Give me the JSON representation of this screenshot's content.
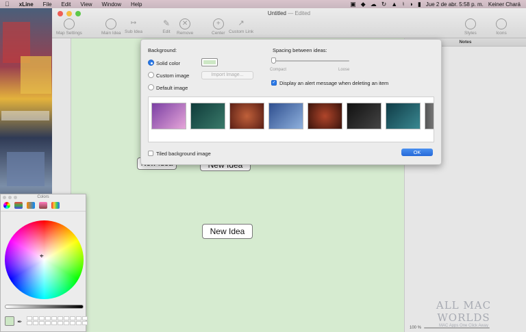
{
  "menubar": {
    "apple": "",
    "app_name": "xLine",
    "items": [
      "File",
      "Edit",
      "View",
      "Window",
      "Help"
    ],
    "datetime": "Jue 2 de abr.  5:58 p. m.",
    "user": "Keiner Chará"
  },
  "window": {
    "title": "Untitled",
    "title_suffix": "— Edited"
  },
  "toolbar": {
    "map_settings": "Map Settings",
    "main_idea": "Main Idea",
    "sub_idea": "Sub Idea",
    "edit": "Edit",
    "remove": "Remove",
    "center": "Center",
    "custom_link": "Custom Link",
    "styles": "Styles",
    "icons": "Icons"
  },
  "notes": {
    "header": "Notes"
  },
  "status": {
    "zoom": "100 %"
  },
  "canvas": {
    "ideas": [
      "New Idea",
      "New Idea",
      "New Idea"
    ]
  },
  "background_popover": {
    "heading": "Background:",
    "solid_color": "Solid color",
    "custom_image": "Custom image",
    "default_image": "Default image",
    "import_button": "Import Image...",
    "spacing_label": "Spacing between ideas:",
    "compact": "Compact",
    "loose": "Loose",
    "alert_label": "Display an alert message when deleting an item",
    "tiled_label": "Tiled background image",
    "ok": "OK"
  },
  "colors_panel": {
    "title": "Colors"
  },
  "watermark": {
    "brand": "ALL MAC WORLDS",
    "tagline": "MAC Apps One Click Away"
  },
  "colors": {
    "canvas_bg": "#d6ebd0",
    "accent": "#2a79e8"
  }
}
